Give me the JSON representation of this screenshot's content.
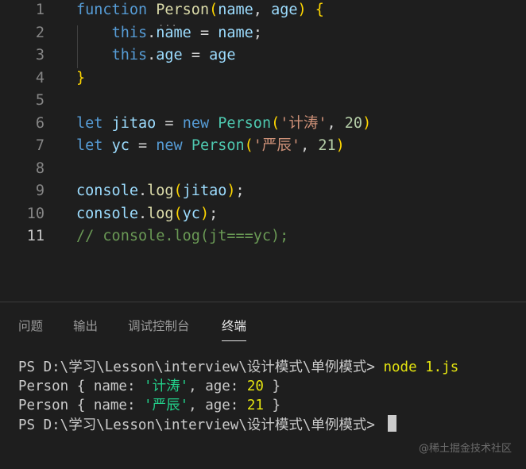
{
  "editor": {
    "active_line": "11",
    "lines": [
      {
        "num": "1",
        "tokens": [
          {
            "t": "function",
            "c": "kw"
          },
          {
            "t": " ",
            "c": "pl"
          },
          {
            "t": "Person",
            "c": "fn"
          },
          {
            "t": "(",
            "c": "br1"
          },
          {
            "t": "name",
            "c": "var"
          },
          {
            "t": ", ",
            "c": "pl"
          },
          {
            "t": "age",
            "c": "var"
          },
          {
            "t": ")",
            "c": "br1"
          },
          {
            "t": " ",
            "c": "pl"
          },
          {
            "t": "{",
            "c": "br1"
          }
        ]
      },
      {
        "num": "2",
        "tokens": [
          {
            "t": "    ",
            "c": "pl"
          },
          {
            "t": "this",
            "c": "kw"
          },
          {
            "t": ".",
            "c": "pl"
          },
          {
            "t": "name",
            "c": "var"
          },
          {
            "t": " = ",
            "c": "pl"
          },
          {
            "t": "name",
            "c": "var"
          },
          {
            "t": ";",
            "c": "pl"
          }
        ]
      },
      {
        "num": "3",
        "tokens": [
          {
            "t": "    ",
            "c": "pl"
          },
          {
            "t": "this",
            "c": "kw"
          },
          {
            "t": ".",
            "c": "pl"
          },
          {
            "t": "age",
            "c": "var"
          },
          {
            "t": " = ",
            "c": "pl"
          },
          {
            "t": "age",
            "c": "var"
          }
        ]
      },
      {
        "num": "4",
        "tokens": [
          {
            "t": "}",
            "c": "br1"
          }
        ]
      },
      {
        "num": "5",
        "tokens": []
      },
      {
        "num": "6",
        "tokens": [
          {
            "t": "let",
            "c": "kw"
          },
          {
            "t": " ",
            "c": "pl"
          },
          {
            "t": "jitao",
            "c": "var"
          },
          {
            "t": " = ",
            "c": "pl"
          },
          {
            "t": "new",
            "c": "kw"
          },
          {
            "t": " ",
            "c": "pl"
          },
          {
            "t": "Person",
            "c": "cls"
          },
          {
            "t": "(",
            "c": "br1"
          },
          {
            "t": "'计涛'",
            "c": "str"
          },
          {
            "t": ", ",
            "c": "pl"
          },
          {
            "t": "20",
            "c": "num"
          },
          {
            "t": ")",
            "c": "br1"
          }
        ]
      },
      {
        "num": "7",
        "tokens": [
          {
            "t": "let",
            "c": "kw"
          },
          {
            "t": " ",
            "c": "pl"
          },
          {
            "t": "yc",
            "c": "var"
          },
          {
            "t": " = ",
            "c": "pl"
          },
          {
            "t": "new",
            "c": "kw"
          },
          {
            "t": " ",
            "c": "pl"
          },
          {
            "t": "Person",
            "c": "cls"
          },
          {
            "t": "(",
            "c": "br1"
          },
          {
            "t": "'严辰'",
            "c": "str"
          },
          {
            "t": ", ",
            "c": "pl"
          },
          {
            "t": "21",
            "c": "num"
          },
          {
            "t": ")",
            "c": "br1"
          }
        ]
      },
      {
        "num": "8",
        "tokens": []
      },
      {
        "num": "9",
        "tokens": [
          {
            "t": "console",
            "c": "var"
          },
          {
            "t": ".",
            "c": "pl"
          },
          {
            "t": "log",
            "c": "fn"
          },
          {
            "t": "(",
            "c": "br1"
          },
          {
            "t": "jitao",
            "c": "var"
          },
          {
            "t": ")",
            "c": "br1"
          },
          {
            "t": ";",
            "c": "pl"
          }
        ]
      },
      {
        "num": "10",
        "tokens": [
          {
            "t": "console",
            "c": "var"
          },
          {
            "t": ".",
            "c": "pl"
          },
          {
            "t": "log",
            "c": "fn"
          },
          {
            "t": "(",
            "c": "br1"
          },
          {
            "t": "yc",
            "c": "var"
          },
          {
            "t": ")",
            "c": "br1"
          },
          {
            "t": ";",
            "c": "pl"
          }
        ]
      },
      {
        "num": "11",
        "tokens": [
          {
            "t": "// console.log(jt===yc);",
            "c": "cmt"
          }
        ]
      }
    ]
  },
  "panel": {
    "tabs": [
      {
        "label": "问题",
        "active": false
      },
      {
        "label": "输出",
        "active": false
      },
      {
        "label": "调试控制台",
        "active": false
      },
      {
        "label": "终端",
        "active": true
      }
    ],
    "terminal": {
      "prompt": "PS D:\\学习\\Lesson\\interview\\设计模式\\单例模式> ",
      "command": "node 1.js",
      "outputs": [
        {
          "prefix": "Person { name: ",
          "name": "'计涛'",
          "mid": ", age: ",
          "age": "20",
          "suffix": " }"
        },
        {
          "prefix": "Person { name: ",
          "name": "'严辰'",
          "mid": ", age: ",
          "age": "21",
          "suffix": " }"
        }
      ]
    }
  },
  "watermark": "@稀土掘金技术社区"
}
